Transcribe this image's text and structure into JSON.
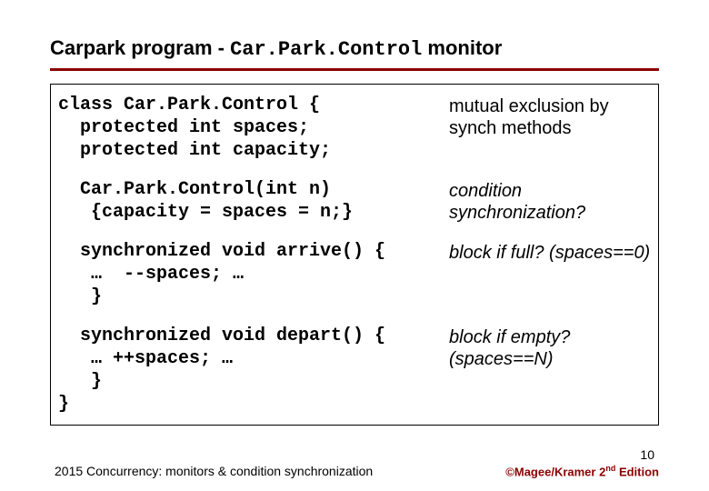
{
  "title": {
    "prefix": "Carpark program - ",
    "mono": "Car.Park.Control",
    "suffix": " monitor"
  },
  "rows": [
    {
      "code": "class Car.Park.Control {\n  protected int spaces;\n  protected int capacity;",
      "note": "mutual exclusion by synch methods",
      "italic": false
    },
    {
      "code": "  Car.Park.Control(int n)\n   {capacity = spaces = n;}",
      "note": "condition synchronization?",
      "italic": true
    },
    {
      "code": "  synchronized void arrive() {\n   …  --spaces; …\n   }",
      "note": "block if full? (spaces==0)",
      "italic": true
    },
    {
      "code": "  synchronized void depart() {\n   … ++spaces; …\n   }\n}",
      "note": "block if empty? (spaces==N)",
      "italic": true
    }
  ],
  "slide_num": "10",
  "footer_left": "2015  Concurrency: monitors & condition synchronization",
  "footer_right_prefix": "©Magee/Kramer ",
  "footer_right_ed": "2",
  "footer_right_suffix": " Edition"
}
